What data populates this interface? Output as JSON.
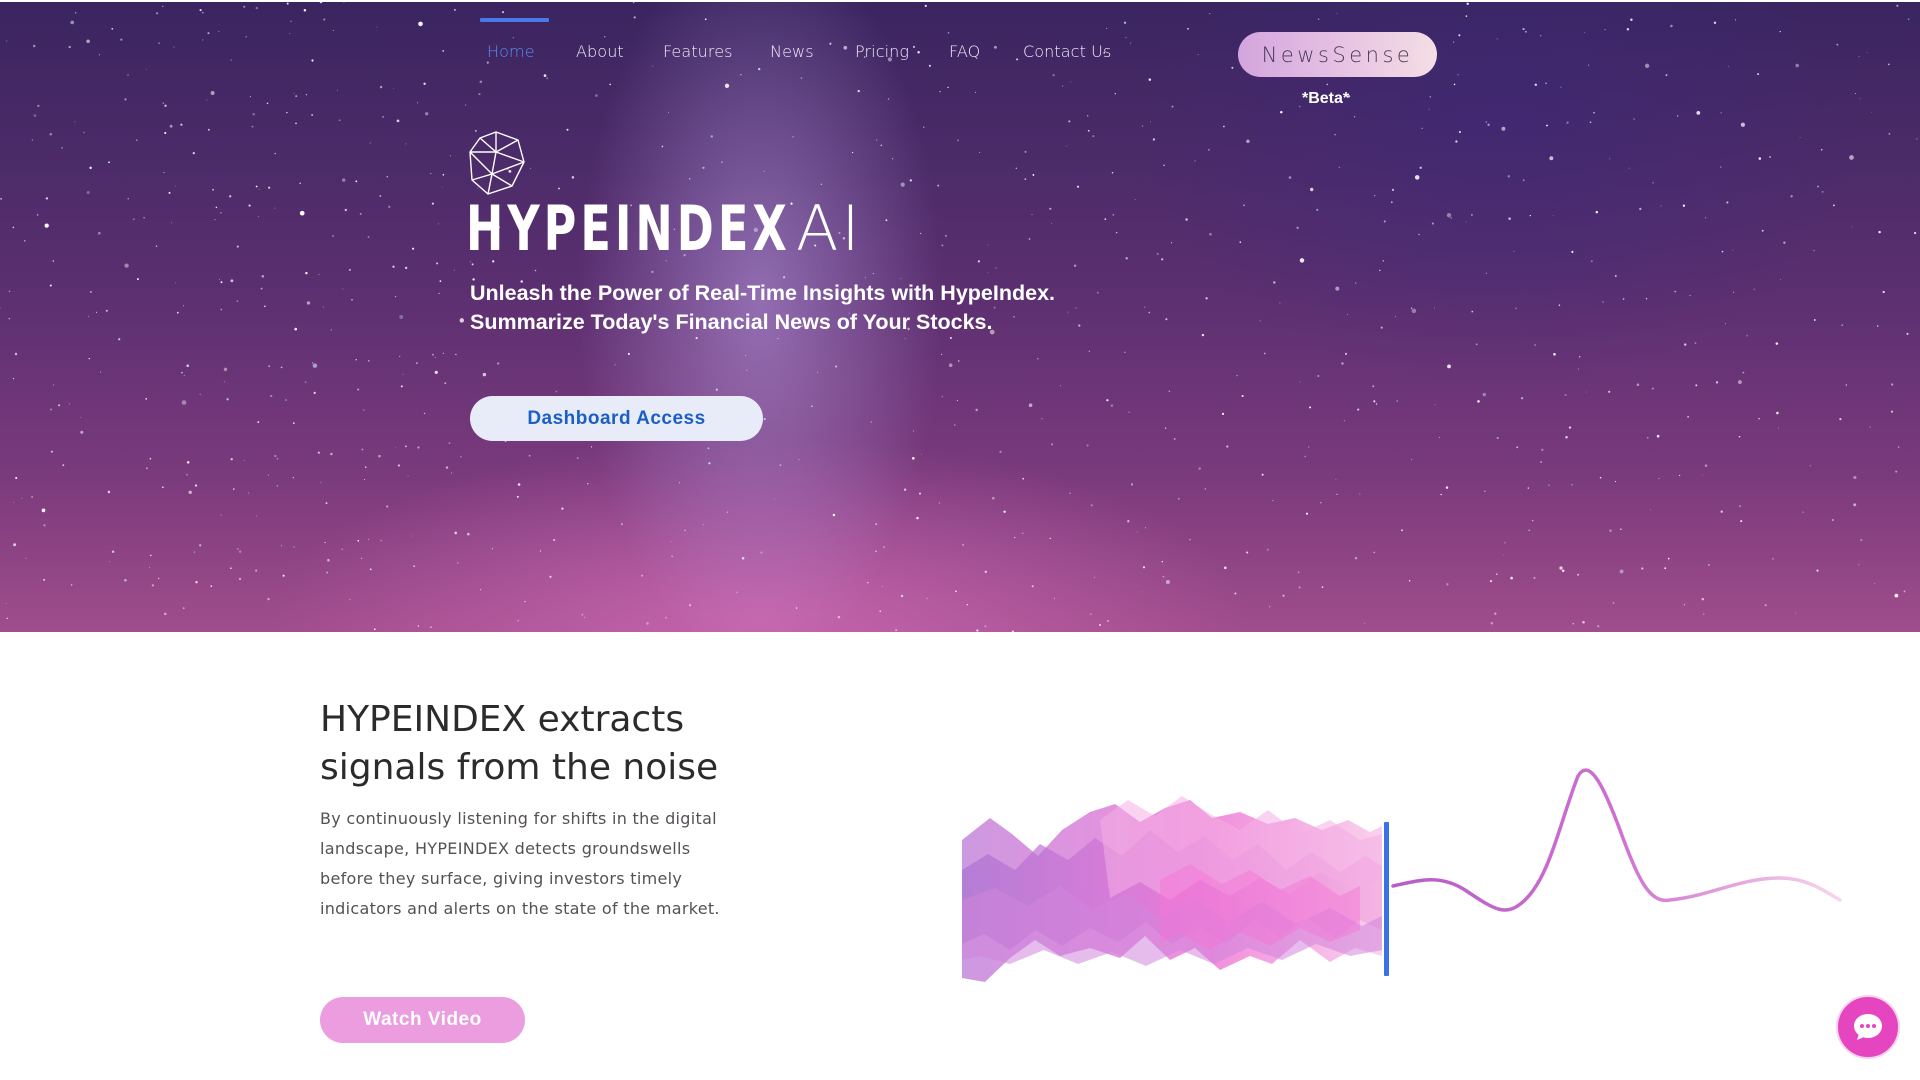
{
  "nav": {
    "items": [
      {
        "label": "Home",
        "active": true
      },
      {
        "label": "About",
        "active": false
      },
      {
        "label": "Features",
        "active": false
      },
      {
        "label": "News",
        "active": false
      },
      {
        "label": "Pricing",
        "active": false
      },
      {
        "label": "FAQ",
        "active": false
      },
      {
        "label": "Contact Us",
        "active": false
      }
    ],
    "active_color": "#5a8cf0"
  },
  "newssense": {
    "label": "NewsSense",
    "badge": "*Beta*"
  },
  "hero": {
    "logo_icon": "geometric-gem-icon",
    "brand_bold": "HYPEINDEX",
    "brand_light": "AI",
    "tagline_line1": "Unleash the Power of Real-Time Insights with HypeIndex.",
    "tagline_line2": "Summarize Today's Financial News of Your Stocks.",
    "cta_label": "Dashboard Access"
  },
  "features": {
    "title_line1": "HYPEINDEX extracts",
    "title_line2": "signals from the noise",
    "body_line1": "By continuously listening for shifts in the digital",
    "body_line2": "landscape, HYPEINDEX detects groundswells",
    "body_line3": "before they surface, giving investors timely",
    "body_line4": "indicators and alerts on the state of the market.",
    "video_label": "Watch Video",
    "graphic_icon": "noise-to-signal-wave-graphic"
  },
  "chat": {
    "icon": "chat-bubble-icon"
  },
  "colors": {
    "accent_blue": "#4a78e8",
    "cta_text": "#1c5fc4",
    "pink": "#ec9de0",
    "chat": "#e645c0"
  }
}
